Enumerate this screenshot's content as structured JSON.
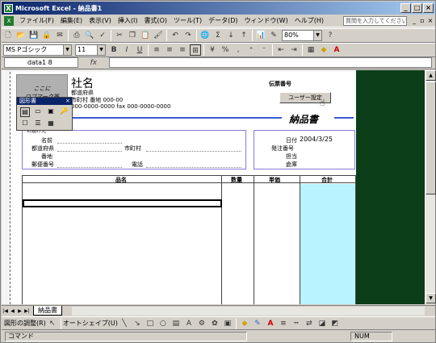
{
  "window": {
    "title": "Microsoft Excel - 納品書1",
    "xl_icon": "X"
  },
  "menu": {
    "items": [
      "ファイル(F)",
      "編集(E)",
      "表示(V)",
      "挿入(I)",
      "書式(O)",
      "ツール(T)",
      "データ(D)",
      "ウィンドウ(W)",
      "ヘルプ(H)"
    ],
    "help_placeholder": "質問を入力してください"
  },
  "toolbar": {
    "zoom": "80%",
    "font_name": "MS Pゴシック",
    "font_size": "11",
    "bold": "B",
    "italic": "I",
    "underline": "U",
    "percent": "%",
    "comma": ",",
    "sum": "Σ"
  },
  "formula": {
    "name_box": "data1 8",
    "fx": "fx"
  },
  "document": {
    "logo_text": "ここに\nロゴマーク等",
    "company": "社名",
    "address1": "都道府県",
    "address2": "市町村 番地 000-00",
    "phone": "000-0000-0000 fax 000-0000-0000",
    "slip_label": "伝票番号",
    "user_settings_button": "ユーザー設定",
    "doc_title": "納品書",
    "left_labels": [
      "名前",
      "都道府県",
      "番地",
      "郵便番号"
    ],
    "city_label": "市町村",
    "tel_label": "電話",
    "right_labels": [
      "日付",
      "発注番号",
      "担当",
      "倉庫"
    ],
    "date": "2004/3/25",
    "headers": [
      "品名",
      "数量",
      "単価",
      "合計"
    ],
    "recipient_label": "お届け先"
  },
  "form_toolbar": {
    "title": "図形書",
    "close": "×"
  },
  "sheets": {
    "tab": "納品書"
  },
  "drawing": {
    "draw_menu": "図形の調整(R)",
    "autoshape": "オートシェイプ(U)"
  },
  "status": {
    "mode": "コマンド",
    "num": "NUM"
  },
  "colors": {
    "titlebar": "#0a246a",
    "total_column": "#b9f3ff",
    "dark_area": "#0b3d19",
    "blue_line": "#3a5bd9"
  }
}
